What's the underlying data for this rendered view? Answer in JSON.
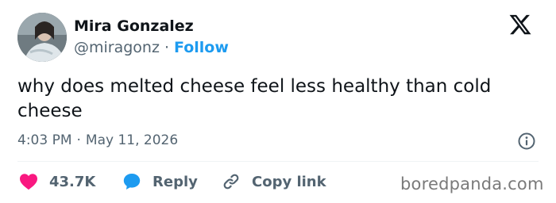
{
  "author": {
    "display_name": "Mira Gonzalez",
    "handle": "@miragonz",
    "separator": "·",
    "follow_label": "Follow"
  },
  "tweet": {
    "text": "why does melted cheese feel less healthy than cold cheese",
    "time": "4:03 PM",
    "separator": "·",
    "date": "May 11, 2026"
  },
  "actions": {
    "like_count": "43.7K",
    "reply_label": "Reply",
    "copy_link_label": "Copy link"
  },
  "watermark": "boredpanda.com",
  "icons": {
    "platform_logo": "x-logo-icon",
    "info": "info-icon",
    "like": "heart-icon",
    "reply": "speech-bubble-icon",
    "copy_link": "link-icon"
  },
  "colors": {
    "text": "#0f1419",
    "secondary_text": "#536471",
    "accent": "#1d9bf0",
    "like": "#f91880"
  }
}
